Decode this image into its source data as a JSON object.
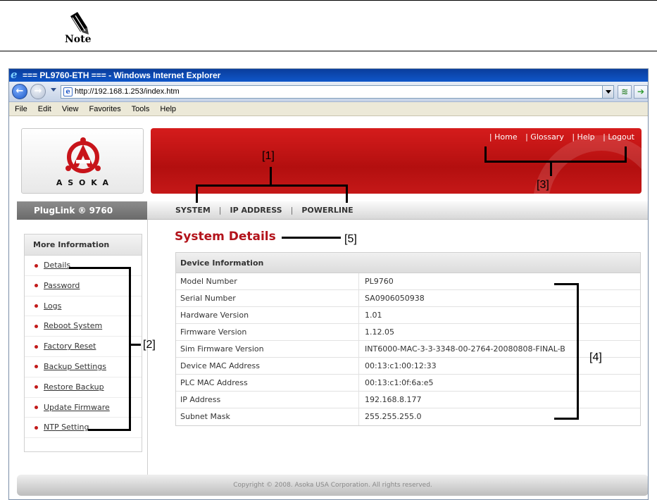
{
  "note": {
    "label": "Note"
  },
  "browser": {
    "title": "=== PL9760-ETH === - Windows Internet Explorer",
    "url": "http://192.168.1.253/index.htm",
    "menu": [
      "File",
      "Edit",
      "View",
      "Favorites",
      "Tools",
      "Help"
    ]
  },
  "brand": {
    "company": "A S O K A",
    "product": "PlugLink ® 9760"
  },
  "top_links": [
    "| Home",
    "| Glossary",
    "| Help",
    "| Logout"
  ],
  "nav": [
    "SYSTEM",
    "IP ADDRESS",
    "POWERLINE"
  ],
  "sidebar": {
    "heading": "More Information",
    "items": [
      "Details",
      "Password",
      "Logs",
      "Reboot System",
      "Factory Reset",
      "Backup Settings",
      "Restore Backup",
      "Update Firmware",
      "NTP Setting"
    ]
  },
  "main": {
    "title": "System Details",
    "table_heading": "Device Information",
    "rows": [
      {
        "k": "Model Number",
        "v": "PL9760"
      },
      {
        "k": "Serial Number",
        "v": "SA0906050938"
      },
      {
        "k": "Hardware Version",
        "v": "1.01"
      },
      {
        "k": "Firmware Version",
        "v": "1.12.05"
      },
      {
        "k": "Sim Firmware Version",
        "v": "INT6000-MAC-3-3-3348-00-2764-20080808-FINAL-B"
      },
      {
        "k": "Device MAC Address",
        "v": "00:13:c1:00:12:33"
      },
      {
        "k": "PLC MAC Address",
        "v": "00:13:c1:0f:6a:e5"
      },
      {
        "k": "IP Address",
        "v": "192.168.8.177"
      },
      {
        "k": "Subnet Mask",
        "v": "255.255.255.0"
      }
    ]
  },
  "footer": "Copyright © 2008. Asoka USA Corporation. All rights reserved.",
  "annotations": [
    "[1]",
    "[2]",
    "[3]",
    "[4]",
    "[5]"
  ],
  "colors": {
    "accent_red": "#b3131b",
    "banner_red": "#c51818"
  }
}
